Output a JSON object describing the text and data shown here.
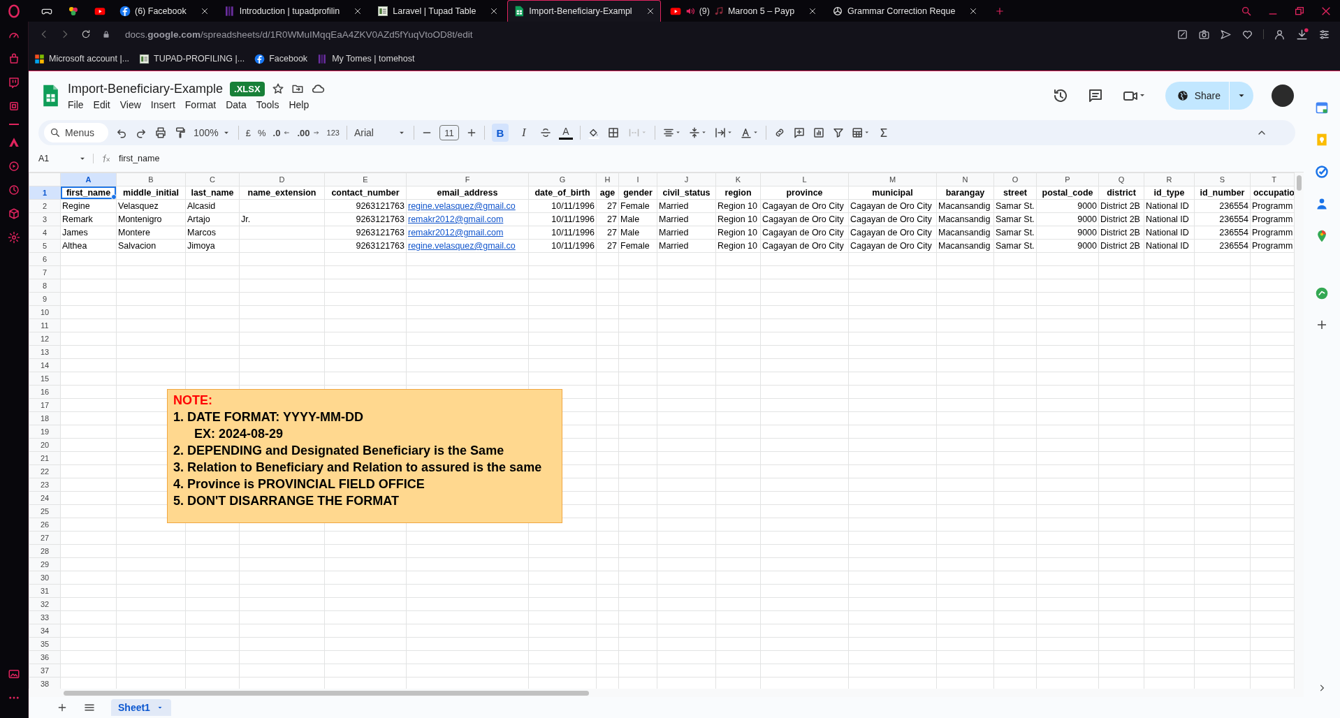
{
  "browser_tabs": [
    {
      "kind": "gamepad",
      "selected": false
    },
    {
      "kind": "apps",
      "selected": false
    },
    {
      "kind": "youtube",
      "selected": false
    },
    {
      "kind": "facebook",
      "title": "(6) Facebook",
      "selected": false
    },
    {
      "kind": "bars",
      "title": "Introduction | tupadprofilin",
      "selected": false
    },
    {
      "kind": "thumb",
      "title": "Laravel | Tupad Table",
      "selected": false
    },
    {
      "kind": "sheets",
      "title": "Import-Beneficiary-Exampl",
      "selected": true
    },
    {
      "kind": "youtube",
      "audio": true,
      "count": "(9)",
      "title": "Maroon 5 – Payp",
      "selected": false
    },
    {
      "kind": "openai",
      "title": "Grammar Correction Reque",
      "selected": false
    }
  ],
  "address_bar": {
    "url": "docs.**google.com**/spreadsheets/d/1R0WMuIMqqEaA4ZKV0AZd5fYuqVtoOD8t/edit"
  },
  "bookmarks": [
    {
      "kind": "microsoft",
      "label": "Microsoft account |..."
    },
    {
      "kind": "thumb",
      "label": "TUPAD-PROFILING |..."
    },
    {
      "kind": "facebook",
      "label": "Facebook"
    },
    {
      "kind": "bars",
      "label": "My Tomes | tomehost"
    }
  ],
  "document": {
    "title": "Import-Beneficiary-Example",
    "badge": ".XLSX",
    "menus": [
      "File",
      "Edit",
      "View",
      "Insert",
      "Format",
      "Data",
      "Tools",
      "Help"
    ],
    "share": "Share"
  },
  "toolbar": {
    "search_placeholder": "Menus",
    "zoom": "100%",
    "currency": "£",
    "percent": "%",
    "decrease_decimal": ".0",
    "increase_decimal": ".00",
    "number_format": "123",
    "font": "Arial",
    "font_size": "11",
    "format_buttons": [
      {
        "label": "B",
        "selected": true
      },
      {
        "label": "I",
        "selected": false
      }
    ],
    "text_color": "A"
  },
  "formula_bar": {
    "cell": "A1",
    "content": "first_name"
  },
  "columns": [
    {
      "letter": "A",
      "kind": "text",
      "selected": true
    },
    {
      "letter": "B",
      "kind": "text",
      "selected": false
    },
    {
      "letter": "C",
      "kind": "text",
      "selected": false
    },
    {
      "letter": "D",
      "kind": "text",
      "selected": false
    },
    {
      "letter": "E",
      "kind": "number",
      "selected": false
    },
    {
      "letter": "F",
      "kind": "link",
      "selected": false
    },
    {
      "letter": "G",
      "kind": "number",
      "selected": false
    },
    {
      "letter": "H",
      "kind": "number",
      "selected": false
    },
    {
      "letter": "I",
      "kind": "text",
      "selected": false
    },
    {
      "letter": "J",
      "kind": "text",
      "selected": false
    },
    {
      "letter": "K",
      "kind": "text",
      "selected": false
    },
    {
      "letter": "L",
      "kind": "text",
      "selected": false
    },
    {
      "letter": "M",
      "kind": "text",
      "selected": false
    },
    {
      "letter": "N",
      "kind": "text",
      "selected": false
    },
    {
      "letter": "O",
      "kind": "text",
      "selected": false
    },
    {
      "letter": "P",
      "kind": "number",
      "selected": false
    },
    {
      "letter": "Q",
      "kind": "text",
      "selected": false
    },
    {
      "letter": "R",
      "kind": "text",
      "selected": false
    },
    {
      "letter": "S",
      "kind": "number",
      "selected": false
    },
    {
      "letter": "T",
      "kind": "text",
      "selected": false
    }
  ],
  "row_headers": [
    {
      "label": "1",
      "selected": true
    },
    {
      "label": "2",
      "selected": false
    },
    {
      "label": "3",
      "selected": false
    },
    {
      "label": "4",
      "selected": false
    },
    {
      "label": "5",
      "selected": false
    },
    {
      "label": "6",
      "selected": false
    },
    {
      "label": "7",
      "selected": false
    },
    {
      "label": "8",
      "selected": false
    },
    {
      "label": "9",
      "selected": false
    },
    {
      "label": "10",
      "selected": false
    },
    {
      "label": "11",
      "selected": false
    },
    {
      "label": "12",
      "selected": false
    },
    {
      "label": "13",
      "selected": false
    },
    {
      "label": "14",
      "selected": false
    },
    {
      "label": "15",
      "selected": false
    },
    {
      "label": "16",
      "selected": false
    },
    {
      "label": "17",
      "selected": false
    },
    {
      "label": "18",
      "selected": false
    },
    {
      "label": "19",
      "selected": false
    },
    {
      "label": "20",
      "selected": false
    },
    {
      "label": "21",
      "selected": false
    },
    {
      "label": "22",
      "selected": false
    },
    {
      "label": "23",
      "selected": false
    },
    {
      "label": "24",
      "selected": false
    },
    {
      "label": "25",
      "selected": false
    },
    {
      "label": "26",
      "selected": false
    },
    {
      "label": "27",
      "selected": false
    },
    {
      "label": "28",
      "selected": false
    },
    {
      "label": "29",
      "selected": false
    },
    {
      "label": "30",
      "selected": false
    },
    {
      "label": "31",
      "selected": false
    },
    {
      "label": "32",
      "selected": false
    },
    {
      "label": "33",
      "selected": false
    },
    {
      "label": "34",
      "selected": false
    },
    {
      "label": "35",
      "selected": false
    },
    {
      "label": "36",
      "selected": false
    },
    {
      "label": "37",
      "selected": false
    },
    {
      "label": "38",
      "selected": false
    }
  ],
  "rows": [
    {
      "bold": true,
      "cells": [
        "first_name",
        "middle_initial",
        "last_name",
        "name_extension",
        "contact_number",
        "email_address",
        "date_of_birth",
        "age",
        "gender",
        "civil_status",
        "region",
        "province",
        "municipal",
        "barangay",
        "street",
        "postal_code",
        "district",
        "id_type",
        "id_number",
        "occupatio"
      ]
    },
    {
      "bold": false,
      "cells": [
        "Regine",
        "Velasquez",
        "Alcasid",
        null,
        "9263121763",
        "regine.velasquez@gmail.co",
        "10/11/1996",
        "27",
        "Female",
        "Married",
        "Region 10",
        "Cagayan de Oro City",
        "Cagayan de Oro City",
        "Macansandig",
        "Samar St.",
        "9000",
        "District 2B",
        "National ID",
        "236554",
        "Programm"
      ]
    },
    {
      "bold": false,
      "cells": [
        "Remark",
        "Montenigro",
        "Artajo",
        "Jr.",
        "9263121763",
        "remakr2012@gmail.com",
        "10/11/1996",
        "27",
        "Male",
        "Married",
        "Region 10",
        "Cagayan de Oro City",
        "Cagayan de Oro City",
        "Macansandig",
        "Samar St.",
        "9000",
        "District 2B",
        "National ID",
        "236554",
        "Programm"
      ]
    },
    {
      "bold": false,
      "cells": [
        "James",
        "Montere",
        "Marcos",
        null,
        "9263121763",
        "remakr2012@gmail.com",
        "10/11/1996",
        "27",
        "Male",
        "Married",
        "Region 10",
        "Cagayan de Oro City",
        "Cagayan de Oro City",
        "Macansandig",
        "Samar St.",
        "9000",
        "District 2B",
        "National ID",
        "236554",
        "Programm"
      ]
    },
    {
      "bold": false,
      "cells": [
        "Althea",
        "Salvacion",
        "Jimoya",
        null,
        "9263121763",
        "regine.velasquez@gmail.co",
        "10/11/1996",
        "27",
        "Female",
        "Married",
        "Region 10",
        "Cagayan de Oro City",
        "Cagayan de Oro City",
        "Macansandig",
        "Samar St.",
        "9000",
        "District 2B",
        "National ID",
        "236554",
        "Programm"
      ]
    }
  ],
  "note": {
    "title": "NOTE:",
    "lines": [
      {
        "text": "1. DATE FORMAT: YYYY-MM-DD",
        "indent": false
      },
      {
        "text": "EX: 2024-08-29",
        "indent": true
      },
      {
        "text": "2. DEPENDING and Designated Beneficiary is the Same",
        "indent": false
      },
      {
        "text": "3. Relation to Beneficiary and Relation to assured is the same",
        "indent": false
      },
      {
        "text": "4. Province is PROVINCIAL FIELD OFFICE",
        "indent": false
      },
      {
        "text": "5. DON'T DISARRANGE THE FORMAT",
        "indent": false
      }
    ]
  },
  "sheet_tabs": [
    {
      "label": "Sheet1",
      "selected": true
    }
  ]
}
